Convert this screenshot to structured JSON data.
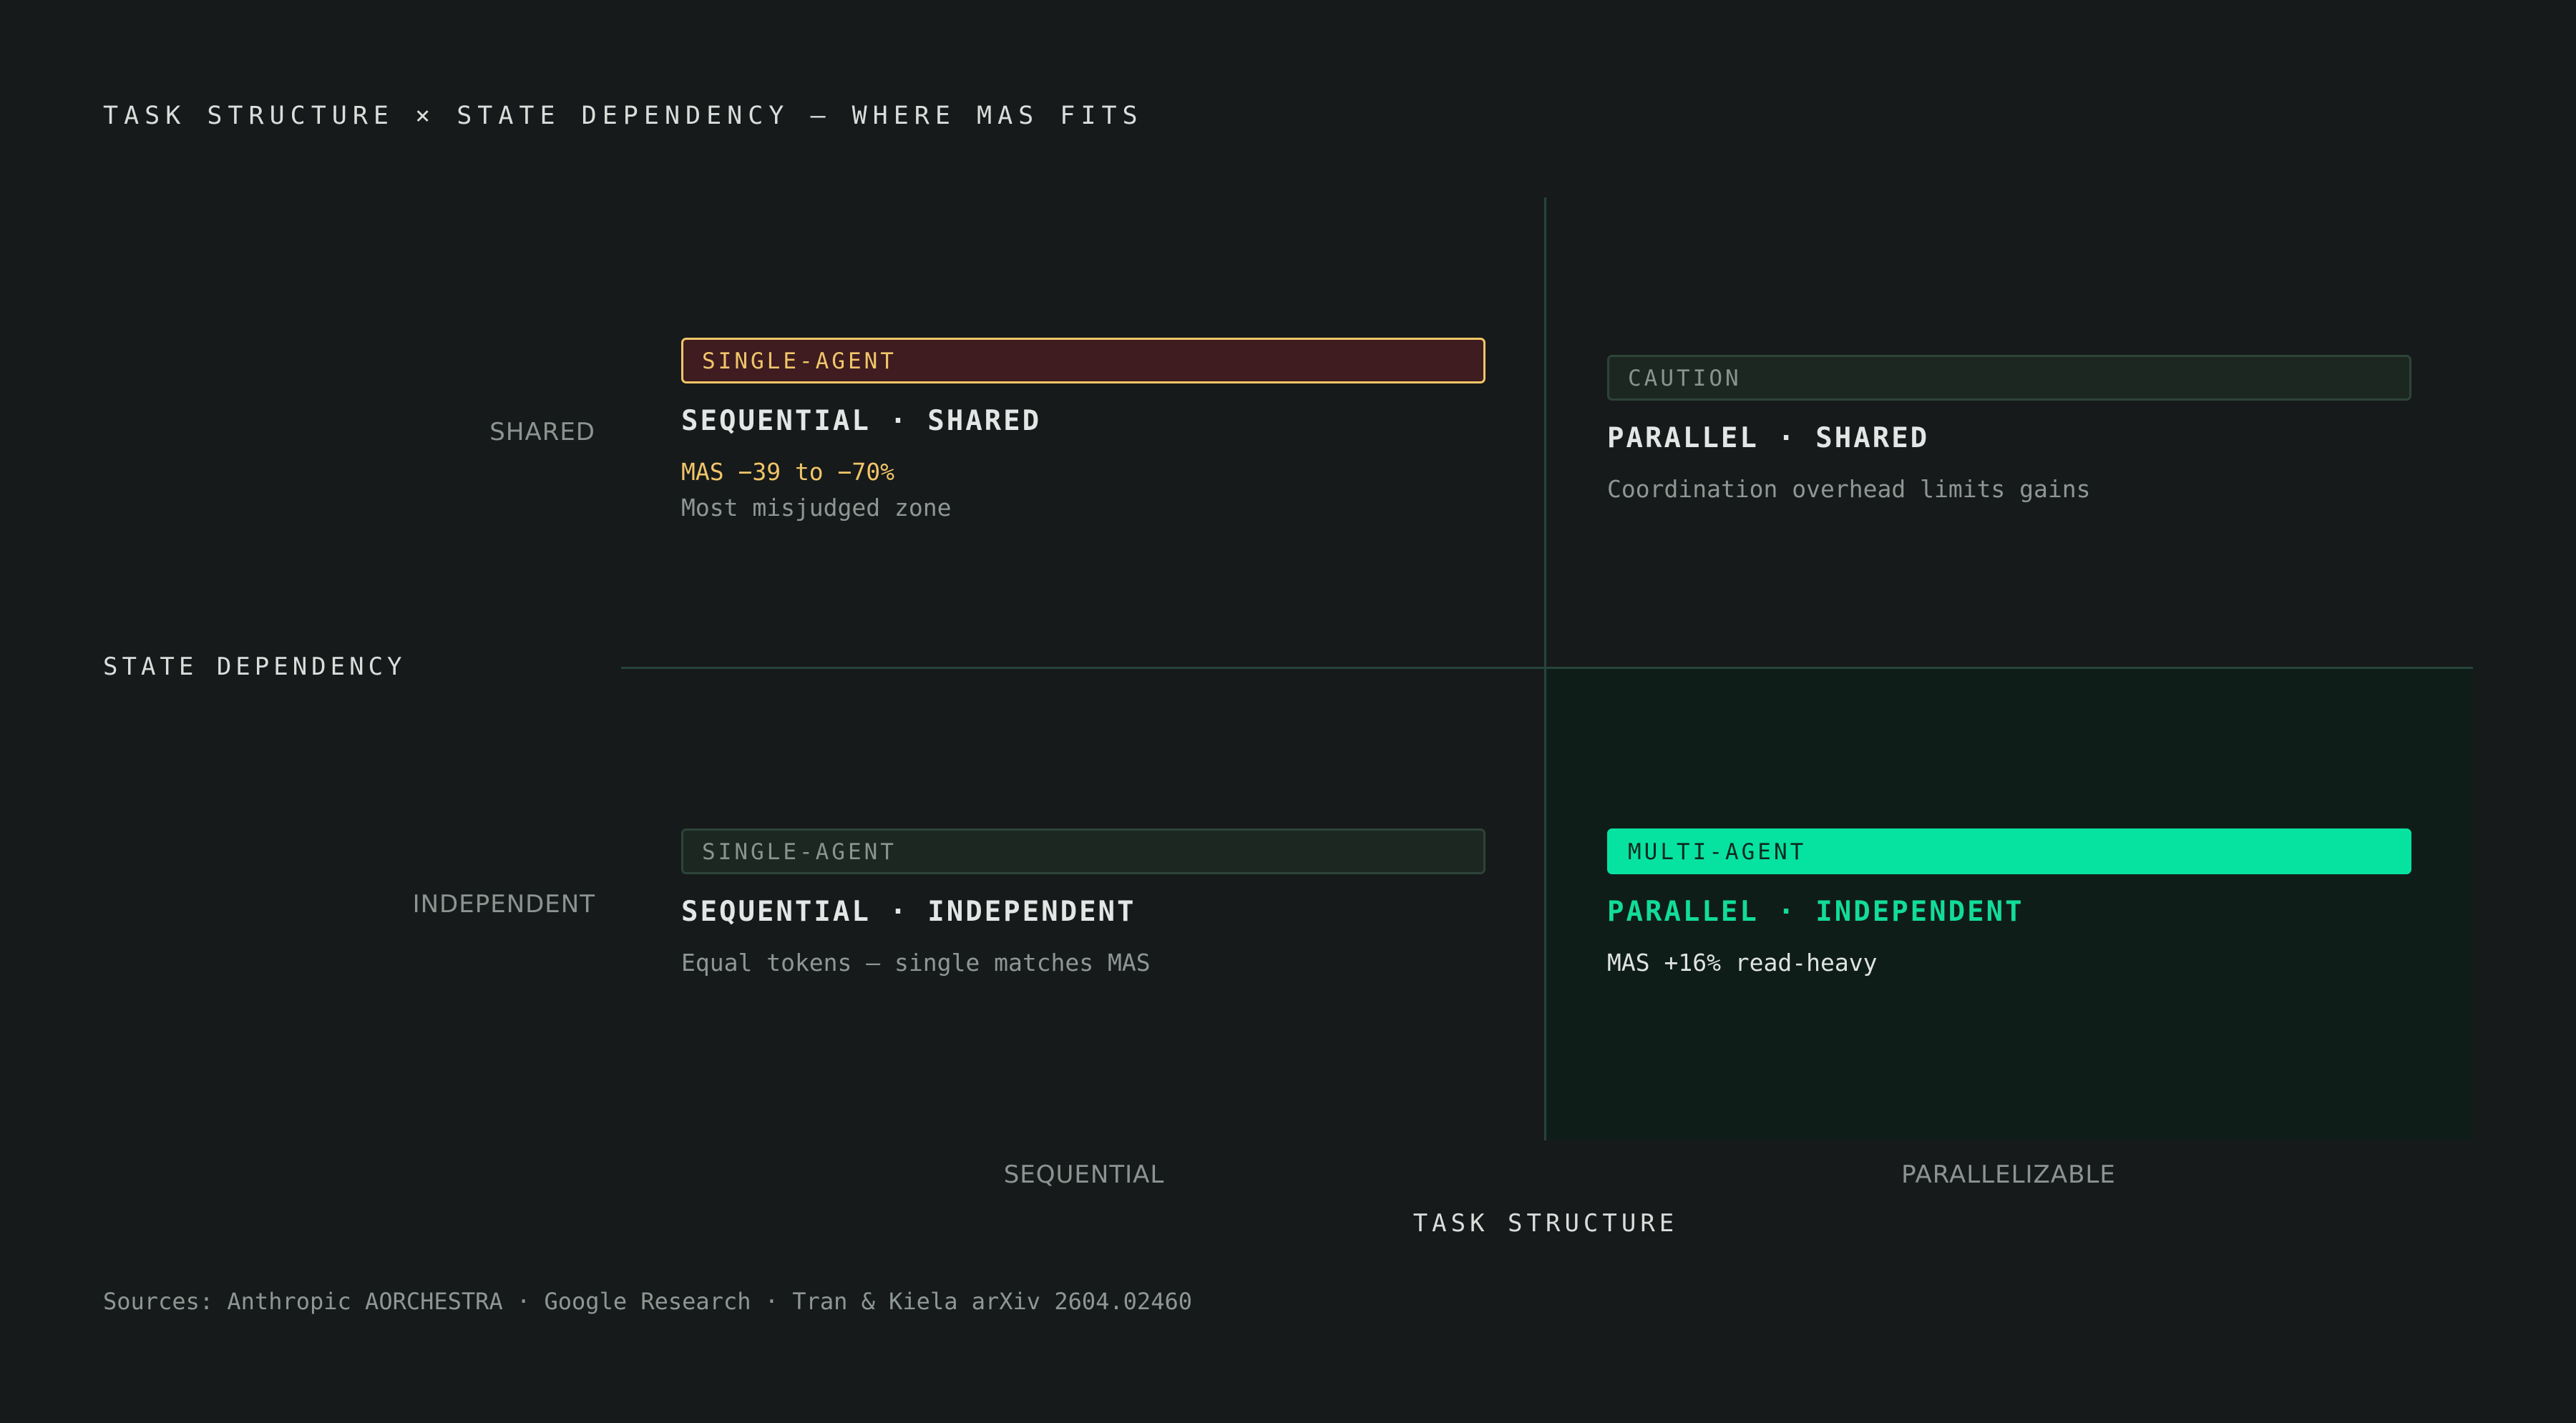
{
  "title": "TASK STRUCTURE × STATE DEPENDENCY — WHERE MAS FITS",
  "y_axis": {
    "title": "STATE DEPENDENCY",
    "labels": [
      "SHARED",
      "INDEPENDENT"
    ]
  },
  "x_axis": {
    "title": "TASK STRUCTURE",
    "labels": [
      "SEQUENTIAL",
      "PARALLELIZABLE"
    ]
  },
  "quadrants": {
    "seq_shared": {
      "badge": "SINGLE-AGENT",
      "title": "SEQUENTIAL · SHARED",
      "line1": "MAS −39 to −70%",
      "line2": "Most misjudged zone"
    },
    "par_shared": {
      "badge": "CAUTION",
      "title": "PARALLEL · SHARED",
      "line1": "Coordination overhead limits gains"
    },
    "seq_indep": {
      "badge": "SINGLE-AGENT",
      "title": "SEQUENTIAL · INDEPENDENT",
      "line1": "Equal tokens — single matches MAS"
    },
    "par_indep": {
      "badge": "MULTI-AGENT",
      "title": "PARALLEL · INDEPENDENT",
      "line1": "MAS +16% read-heavy"
    }
  },
  "sources": "Sources: Anthropic AORCHESTRA · Google Research · Tran & Kiela arXiv 2604.02460",
  "colors": {
    "background": "#171a1a",
    "accent": "#06e3a0",
    "warning": "#f0c56a",
    "warning_fill": "#3e1c1f",
    "grid": "#26443a"
  }
}
